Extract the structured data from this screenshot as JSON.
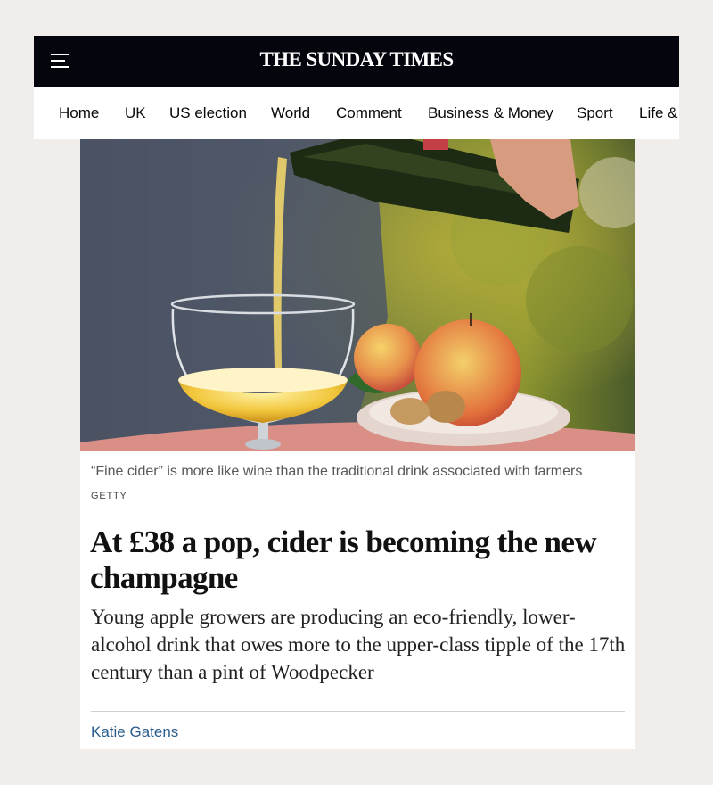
{
  "header": {
    "masthead": "THE SUNDAY TIMES",
    "menu_icon": "hamburger-menu-icon",
    "background_color": "#05050e"
  },
  "nav": {
    "items": [
      "Home",
      "UK",
      "US election",
      "World",
      "Comment",
      "Business & Money",
      "Sport",
      "Life &"
    ]
  },
  "article": {
    "image_caption": "“Fine cider” is more like wine than the traditional drink associated with farmers",
    "image_credit": "GETTY",
    "headline": "At £38 a pop, cider is becoming the new champagne",
    "standfirst": "Young apple growers are producing an eco-friendly, lower-alcohol drink that owes more to the upper-class tipple of the 17th century than a pint of Woodpecker",
    "author": "Katie Gatens",
    "byline_color": "#2a5c8c"
  }
}
